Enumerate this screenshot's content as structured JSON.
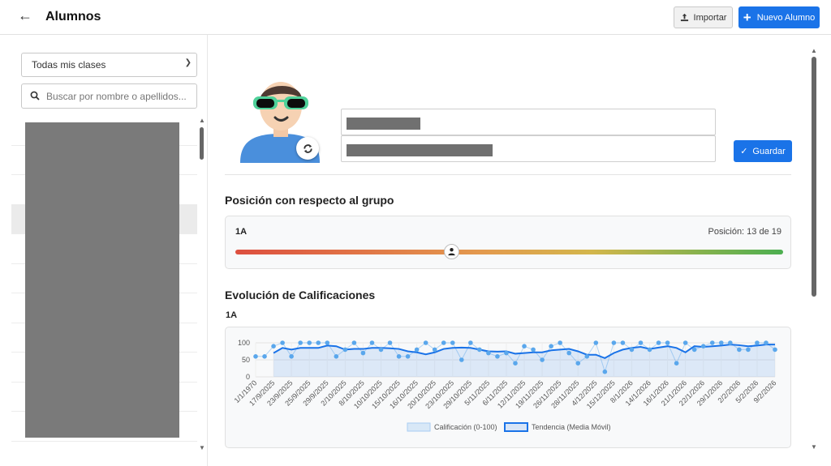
{
  "header": {
    "title": "Alumnos",
    "import_label": "Importar",
    "new_label": "Nuevo Alumno"
  },
  "sidebar": {
    "class_select_value": "Todas mis clases",
    "search_placeholder": "Buscar por nombre o apellidos..."
  },
  "profile": {
    "save_label": "Guardar"
  },
  "position": {
    "heading": "Posición con respecto al grupo",
    "group": "1A",
    "position_text": "Posición: 13 de 19",
    "rank": 13,
    "total": 19
  },
  "evolution": {
    "heading": "Evolución de Calificaciones",
    "group": "1A"
  },
  "colors": {
    "accent": "#1a73e8",
    "series_point": "#5aa7ec",
    "trend": "#1a73e8"
  },
  "chart_data": {
    "type": "line",
    "ylim": [
      0,
      100
    ],
    "yticks": [
      0,
      50,
      100
    ],
    "xticks": [
      "1/1/1970",
      "17/9/2025",
      "23/9/2025",
      "25/9/2025",
      "29/9/2025",
      "2/10/2025",
      "8/10/2025",
      "10/10/2025",
      "15/10/2025",
      "16/10/2025",
      "20/10/2025",
      "23/10/2025",
      "29/10/2025",
      "5/11/2025",
      "6/11/2025",
      "12/11/2025",
      "19/11/2025",
      "26/11/2025",
      "28/11/2025",
      "4/12/2025",
      "15/12/2025",
      "8/1/2026",
      "14/1/2026",
      "16/1/2026",
      "21/1/2026",
      "22/1/2026",
      "29/1/2026",
      "2/2/2026",
      "5/2/2026",
      "9/2/2026"
    ],
    "series": [
      {
        "name": "Calificación (0-100)",
        "values": [
          60,
          60,
          90,
          100,
          60,
          100,
          100,
          100,
          100,
          60,
          80,
          100,
          70,
          100,
          80,
          100,
          60,
          60,
          80,
          100,
          80,
          100,
          100,
          50,
          100,
          80,
          70,
          60,
          70,
          40,
          90,
          80,
          50,
          90,
          100,
          70,
          40,
          60,
          100,
          15,
          100,
          100,
          80,
          100,
          80,
          100,
          100,
          40,
          100,
          80,
          90,
          100,
          100,
          100,
          80,
          80,
          100,
          100,
          80
        ]
      },
      {
        "name": "Tendencia (Media Móvil)",
        "values": [
          null,
          null,
          70,
          85,
          80,
          85,
          85,
          85,
          92,
          90,
          80,
          82,
          82,
          85,
          85,
          84,
          82,
          75,
          72,
          66,
          72,
          82,
          85,
          86,
          85,
          80,
          75,
          74,
          75,
          68,
          70,
          72,
          72,
          78,
          80,
          82,
          75,
          65,
          65,
          55,
          70,
          80,
          85,
          88,
          82,
          86,
          90,
          85,
          72,
          90,
          88,
          90,
          92,
          95,
          93,
          90,
          92,
          95,
          95
        ]
      }
    ],
    "legend": [
      "Calificación (0-100)",
      "Tendencia (Media Móvil)"
    ],
    "legend_position": "bottom",
    "grid": true
  }
}
